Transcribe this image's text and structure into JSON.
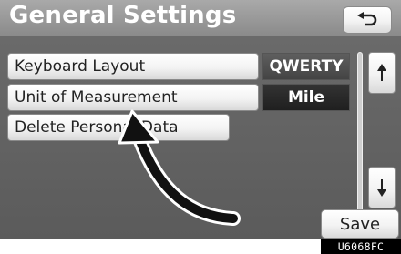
{
  "header": {
    "title": "General Settings",
    "back_icon": "return-arrow-icon"
  },
  "settings": [
    {
      "label": "Keyboard Layout",
      "value": "QWERTY"
    },
    {
      "label": "Unit of Measurement",
      "value": "Mile"
    },
    {
      "label": "Delete Personal Data"
    }
  ],
  "scroll": {
    "up_icon": "arrow-up-icon",
    "down_icon": "arrow-down-icon"
  },
  "actions": {
    "save_label": "Save"
  },
  "figure_code": "U6068FC"
}
